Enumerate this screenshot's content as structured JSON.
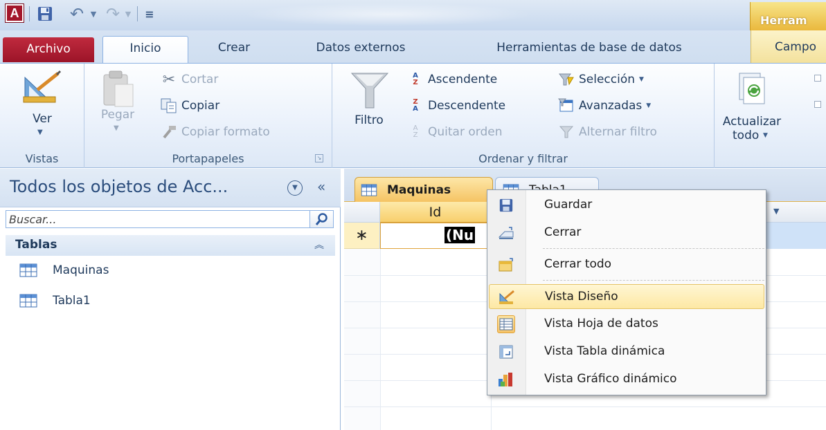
{
  "app": {
    "icon_letter": "A",
    "contextual_tab_header": "Herram"
  },
  "ribbon_tabs": {
    "archivo": "Archivo",
    "inicio": "Inicio",
    "crear": "Crear",
    "datos_externos": "Datos externos",
    "herramientas": "Herramientas de base de datos",
    "campos": "Campo"
  },
  "ribbon": {
    "vistas": {
      "ver_label": "Ver",
      "group_label": "Vistas"
    },
    "portapapeles": {
      "pegar_label": "Pegar",
      "cortar_label": "Cortar",
      "copiar_label": "Copiar",
      "copiar_formato_label": "Copiar formato",
      "group_label": "Portapapeles"
    },
    "ordenar": {
      "filtro_label": "Filtro",
      "ascendente_label": "Ascendente",
      "descendente_label": "Descendente",
      "quitar_orden_label": "Quitar orden",
      "seleccion_label": "Selección",
      "avanzadas_label": "Avanzadas",
      "alternar_filtro_label": "Alternar filtro",
      "group_label": "Ordenar y filtrar"
    },
    "actualizar": {
      "label_line1": "Actualizar",
      "label_line2": "todo"
    }
  },
  "nav_pane": {
    "title": "Todos los objetos de Acc...",
    "search_placeholder": "Buscar...",
    "group_title": "Tablas",
    "items": [
      {
        "label": "Maquinas"
      },
      {
        "label": "Tabla1"
      }
    ]
  },
  "document": {
    "tabs": [
      {
        "label": "Maquinas"
      },
      {
        "label": "Tabla1"
      }
    ],
    "grid": {
      "column_id": "Id",
      "new_row_marker": "∗",
      "new_row_value": "(Nu"
    }
  },
  "context_menu": {
    "items": [
      {
        "label": "Guardar",
        "icon": "save-icon"
      },
      {
        "label": "Cerrar",
        "icon": "close-window-icon"
      },
      {
        "label": "Cerrar todo",
        "icon": "close-all-icon"
      },
      {
        "label": "Vista Diseño",
        "icon": "design-view-icon",
        "highlighted": true
      },
      {
        "label": "Vista Hoja de datos",
        "icon": "datasheet-view-icon",
        "checked": true
      },
      {
        "label": "Vista Tabla dinámica",
        "icon": "pivot-table-icon"
      },
      {
        "label": "Vista Gráfico dinámico",
        "icon": "pivot-chart-icon"
      }
    ]
  },
  "colors": {
    "archivo_tab": "#b01e33",
    "contextual_accent": "#eab83d",
    "active_doc_tab": "#f5c463",
    "menu_highlight": "#fde8a4"
  }
}
